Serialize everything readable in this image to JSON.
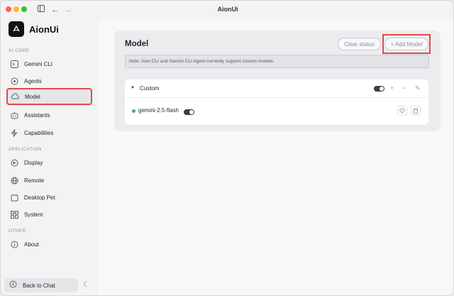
{
  "window": {
    "title": "AionUi"
  },
  "titlebar": {
    "sidebar_toggle_icon": "sidebar-icon",
    "back_icon": "arrow-left-icon",
    "forward_icon": "arrow-right-icon"
  },
  "sidebar": {
    "brand": "AionUi",
    "sections": {
      "ai_core": "AI CORE",
      "application": "APPLICATION",
      "other": "OTHER"
    },
    "items": [
      {
        "label": "Gemini CLI",
        "icon": "gemini-icon"
      },
      {
        "label": "Agents",
        "icon": "agents-icon"
      },
      {
        "label": "Model",
        "icon": "cloud-icon",
        "active": true
      },
      {
        "label": "Assistants",
        "icon": "robot-icon"
      },
      {
        "label": "Capabilities",
        "icon": "lightning-icon"
      },
      {
        "label": "Display",
        "icon": "display-icon"
      },
      {
        "label": "Remote",
        "icon": "globe-icon"
      },
      {
        "label": "Desktop Pet",
        "icon": "pet-icon"
      },
      {
        "label": "System",
        "icon": "grid-icon"
      },
      {
        "label": "About",
        "icon": "info-icon"
      }
    ],
    "back_to_chat": "Back to Chat",
    "theme_icon": "moon-icon"
  },
  "main": {
    "title": "Model",
    "clear_status": "Clear status",
    "add_model": "+ Add Model",
    "note": "Note: Aion CLI and Gemini CLI Agent currently support custom models.",
    "group": {
      "name": "Custom",
      "enabled": true,
      "models": [
        {
          "name": "gemini-2.5-flash",
          "status": "online",
          "enabled": true
        }
      ]
    }
  },
  "colors": {
    "accent": "#e14a4a",
    "status_online": "#2db55d"
  }
}
